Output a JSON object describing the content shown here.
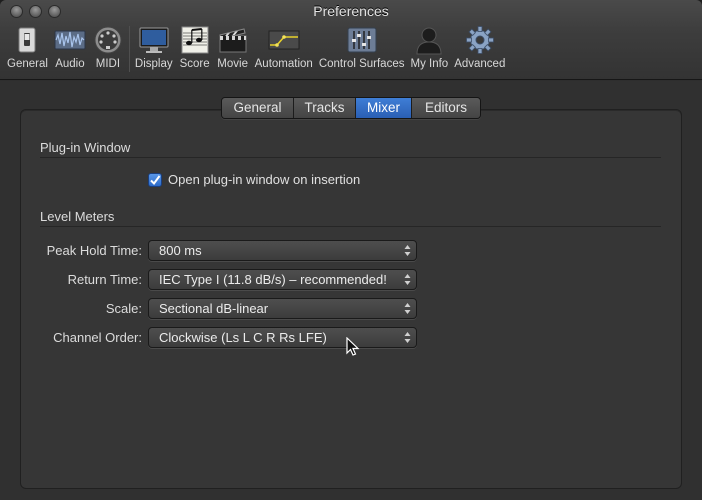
{
  "window": {
    "title": "Preferences"
  },
  "toolbar": {
    "items": [
      {
        "label": "General",
        "icon": "general-switch-icon"
      },
      {
        "label": "Audio",
        "icon": "audio-waveform-icon"
      },
      {
        "label": "MIDI",
        "icon": "midi-connector-icon"
      },
      {
        "label": "Display",
        "icon": "display-monitor-icon"
      },
      {
        "label": "Score",
        "icon": "score-notes-icon"
      },
      {
        "label": "Movie",
        "icon": "movie-clapper-icon"
      },
      {
        "label": "Automation",
        "icon": "automation-curve-icon"
      },
      {
        "label": "Control Surfaces",
        "icon": "control-surfaces-faders-icon"
      },
      {
        "label": "My Info",
        "icon": "my-info-person-icon"
      },
      {
        "label": "Advanced",
        "icon": "advanced-gear-icon"
      }
    ]
  },
  "tabs": [
    {
      "label": "General",
      "active": false
    },
    {
      "label": "Tracks",
      "active": false
    },
    {
      "label": "Mixer",
      "active": true
    },
    {
      "label": "Editors",
      "active": false
    }
  ],
  "plugin_window": {
    "title": "Plug-in Window",
    "open_on_insertion": {
      "label": "Open plug-in window on insertion",
      "checked": true
    }
  },
  "level_meters": {
    "title": "Level Meters",
    "peak_hold_time": {
      "label": "Peak Hold Time:",
      "value": "800 ms"
    },
    "return_time": {
      "label": "Return Time:",
      "value": "IEC Type I (11.8 dB/s) – recommended!"
    },
    "scale": {
      "label": "Scale:",
      "value": "Sectional dB-linear"
    },
    "channel_order": {
      "label": "Channel Order:",
      "value": "Clockwise (Ls L C R Rs LFE)"
    }
  },
  "colors": {
    "accent": "#2f6bc4",
    "background": "#303030",
    "panel": "#363636"
  }
}
